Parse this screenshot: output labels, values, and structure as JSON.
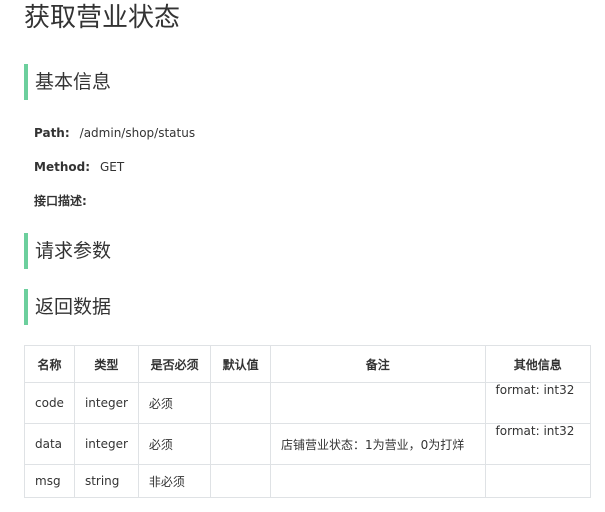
{
  "page": {
    "title": "获取营业状态"
  },
  "sections": {
    "basic": "基本信息",
    "request": "请求参数",
    "response": "返回数据"
  },
  "basic_info": {
    "path_label": "Path:",
    "path_value": "/admin/shop/status",
    "method_label": "Method:",
    "method_value": "GET",
    "desc_label": "接口描述:",
    "desc_value": ""
  },
  "response_table": {
    "headers": [
      "名称",
      "类型",
      "是否必须",
      "默认值",
      "备注",
      "其他信息"
    ],
    "rows": [
      {
        "name": "code",
        "type": "integer",
        "required": "必须",
        "default": "",
        "note": "",
        "other": "format: int32"
      },
      {
        "name": "data",
        "type": "integer",
        "required": "必须",
        "default": "",
        "note": "店铺营业状态：1为营业，0为打烊",
        "other": "format: int32"
      },
      {
        "name": "msg",
        "type": "string",
        "required": "非必须",
        "default": "",
        "note": "",
        "other": ""
      }
    ]
  },
  "colors": {
    "accent": "#6ccf9d",
    "border": "#dfe2e5",
    "text": "#333333"
  }
}
